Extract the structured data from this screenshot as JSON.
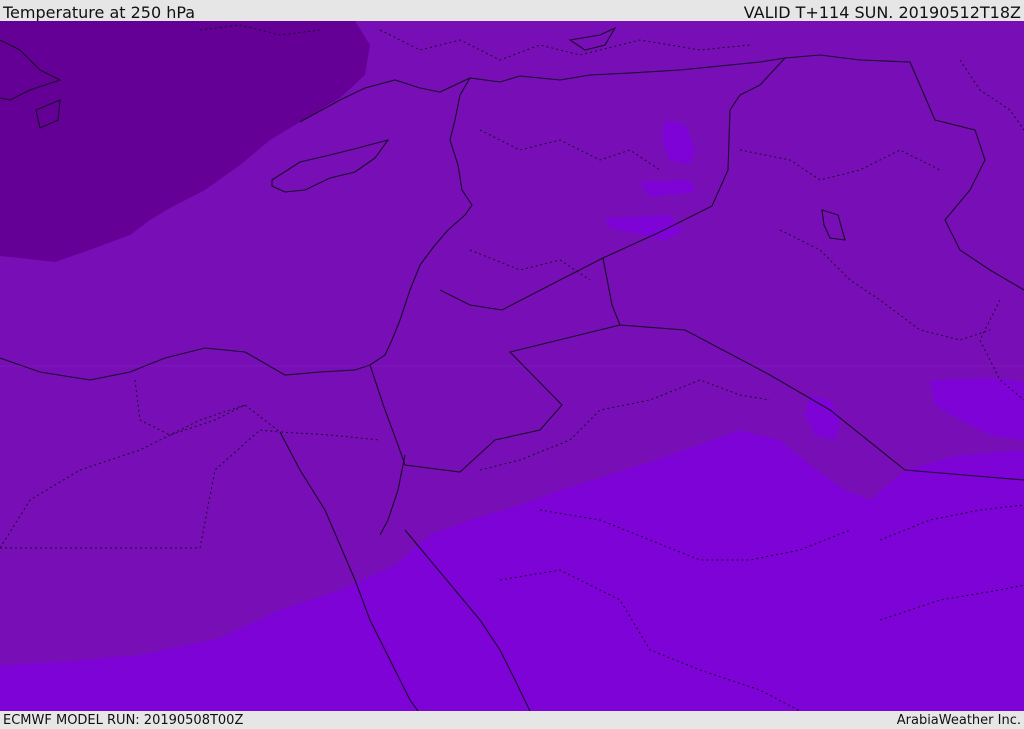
{
  "header": {
    "title": "Temperature at 250 hPa",
    "valid": "VALID T+114 SUN. 20190512T18Z"
  },
  "footer": {
    "model_run": "ECMWF MODEL RUN: 20190508T00Z",
    "brand": "ArabiaWeather Inc."
  },
  "map": {
    "variable": "Temperature",
    "level": "250 hPa",
    "shading_colors": {
      "coldest": "#650096",
      "cold": "#780fb6",
      "mild": "#7e03d7"
    },
    "boundary_color": "#1a0a2a"
  }
}
